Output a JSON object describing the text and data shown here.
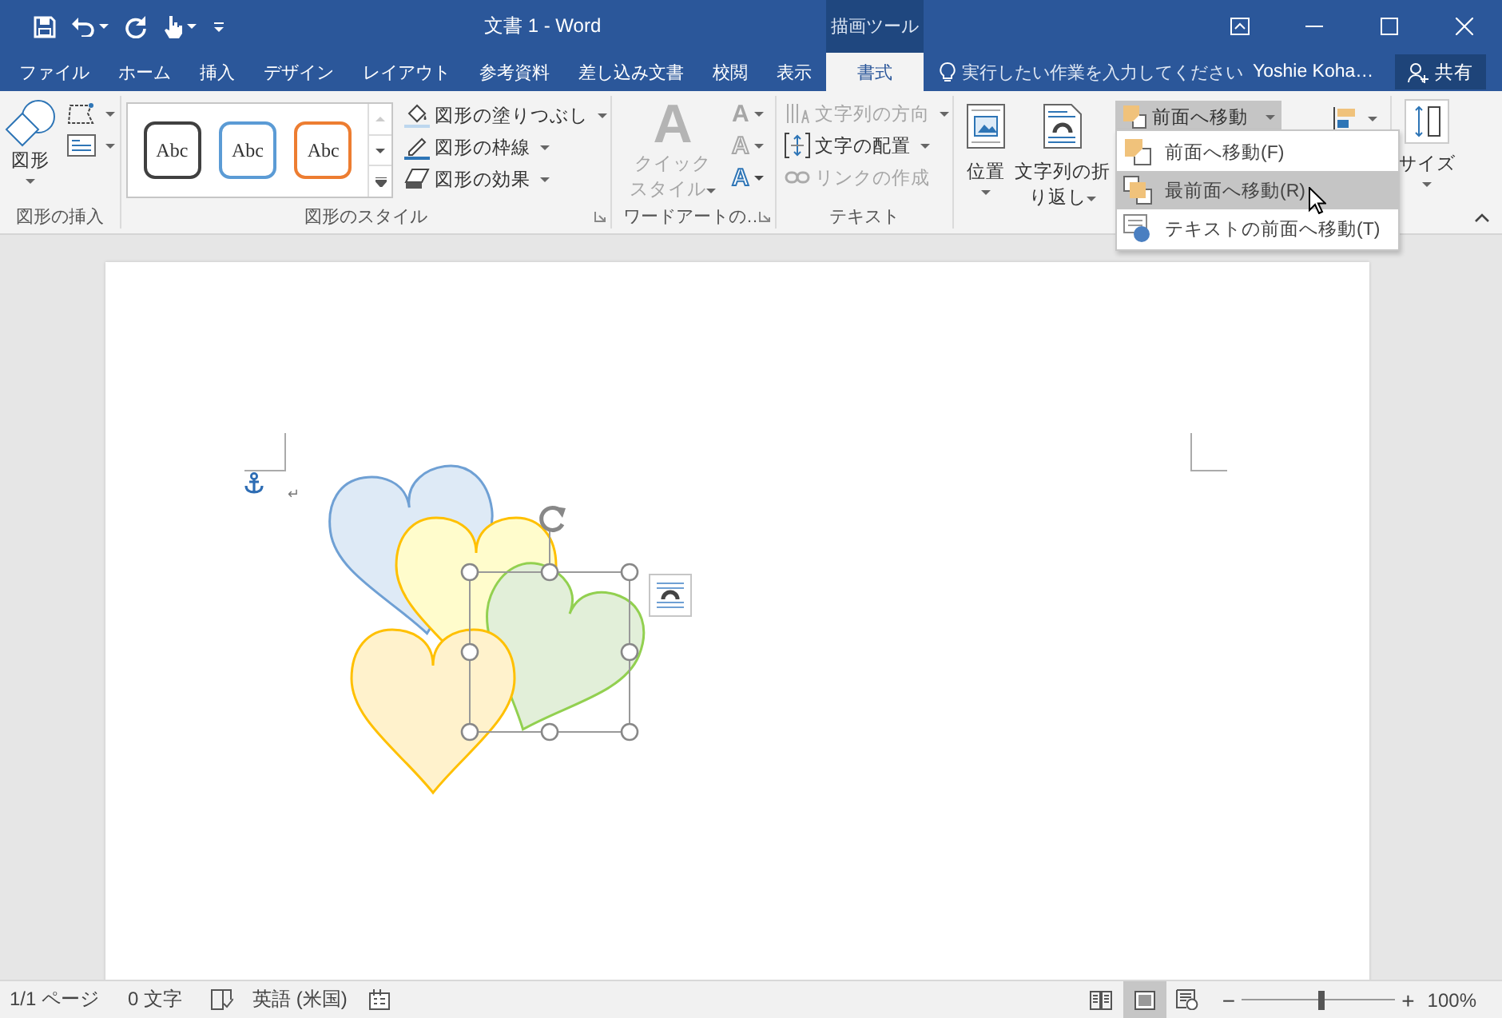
{
  "window": {
    "title": "文書 1 - Word",
    "context_label": "描画ツール"
  },
  "tabs": [
    {
      "label": "ファイル",
      "selected": false
    },
    {
      "label": "ホーム",
      "selected": false
    },
    {
      "label": "挿入",
      "selected": false
    },
    {
      "label": "デザイン",
      "selected": false
    },
    {
      "label": "レイアウト",
      "selected": false
    },
    {
      "label": "参考資料",
      "selected": false
    },
    {
      "label": "差し込み文書",
      "selected": false
    },
    {
      "label": "校閲",
      "selected": false
    },
    {
      "label": "表示",
      "selected": false
    },
    {
      "label": "書式",
      "selected": true
    }
  ],
  "tell_me": {
    "placeholder": "実行したい作業を入力してください"
  },
  "user": {
    "name": "Yoshie Koha…"
  },
  "share": {
    "label": "共有"
  },
  "ribbon": {
    "insert_shapes": {
      "label": "図形の挿入",
      "shapes_button": "図形"
    },
    "shape_styles": {
      "label": "図形のスタイル",
      "gallery": [
        {
          "label": "Abc",
          "color": "#404040"
        },
        {
          "label": "Abc",
          "color": "#5b9bd5"
        },
        {
          "label": "Abc",
          "color": "#ed7d31"
        }
      ],
      "commands": [
        {
          "label": "図形の塗りつぶし"
        },
        {
          "label": "図形の枠線"
        },
        {
          "label": "図形の効果"
        }
      ]
    },
    "wordart": {
      "label": "ワードアートの…",
      "quick_styles": {
        "glyph": "A",
        "lines": [
          "クイック",
          "スタイル"
        ],
        "disabled": true
      },
      "text_effects": [
        {
          "glyph": "A",
          "kind": "fill",
          "disabled": true
        },
        {
          "glyph": "A",
          "kind": "outline",
          "disabled": true
        },
        {
          "glyph": "A",
          "kind": "effects",
          "disabled": false
        }
      ]
    },
    "text": {
      "label": "テキスト",
      "commands": [
        {
          "label": "文字列の方向",
          "kind": "direction",
          "disabled": true
        },
        {
          "label": "文字の配置",
          "kind": "align",
          "disabled": false
        },
        {
          "label": "リンクの作成",
          "kind": "link",
          "disabled": true
        }
      ]
    },
    "arrange": {
      "position": "位置",
      "wrap_lines": [
        "文字列の折",
        "り返し"
      ],
      "bring_forward": {
        "label": "前面へ移動",
        "expanded": true
      }
    },
    "size": {
      "label": "サイズ"
    }
  },
  "menu": {
    "items": [
      {
        "label": "前面へ移動(F)",
        "kind": "forward",
        "selected": false
      },
      {
        "label": "最前面へ移動(R)",
        "kind": "front",
        "selected": true
      },
      {
        "label": "テキストの前面へ移動(T)",
        "kind": "text-front",
        "selected": false
      }
    ]
  },
  "document": {
    "paragraph_mark": "↵"
  },
  "status_bar": {
    "page": "1/1 ページ",
    "words": "0 文字",
    "language": "英語 (米国)",
    "views": [
      {
        "kind": "read",
        "selected": false
      },
      {
        "kind": "print",
        "selected": true
      },
      {
        "kind": "web",
        "selected": false
      }
    ],
    "zoom": {
      "minus": "−",
      "plus": "+",
      "level": 0.5,
      "reading": "100%"
    }
  }
}
